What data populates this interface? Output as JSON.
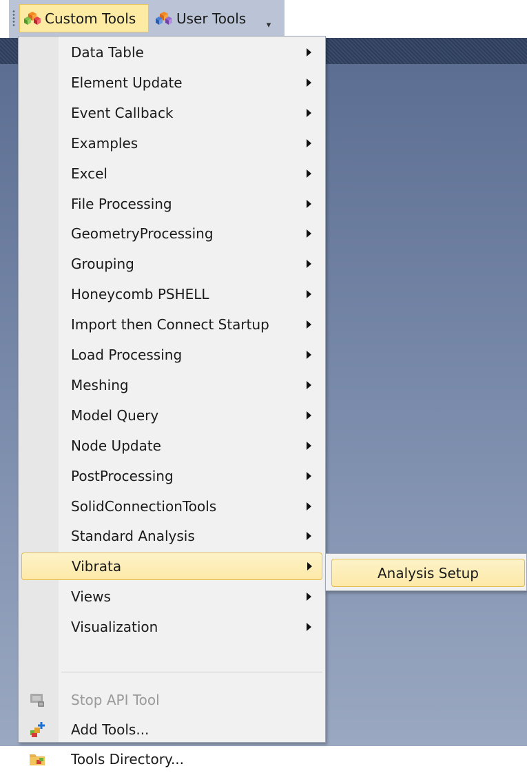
{
  "toolbar": {
    "custom_tools": {
      "label": "Custom Tools",
      "icon": "cubes-icon"
    },
    "user_tools": {
      "label": "User Tools",
      "icon": "cubes-user-icon"
    },
    "overflow_icon": "overflow-chevron-icon"
  },
  "menu": {
    "items": [
      {
        "label": "Data Table",
        "submenu": true
      },
      {
        "label": "Element Update",
        "submenu": true
      },
      {
        "label": "Event Callback",
        "submenu": true
      },
      {
        "label": "Examples",
        "submenu": true
      },
      {
        "label": "Excel",
        "submenu": true
      },
      {
        "label": "File Processing",
        "submenu": true
      },
      {
        "label": "GeometryProcessing",
        "submenu": true
      },
      {
        "label": "Grouping",
        "submenu": true
      },
      {
        "label": "Honeycomb PSHELL",
        "submenu": true
      },
      {
        "label": "Import then Connect Startup",
        "submenu": true
      },
      {
        "label": "Load Processing",
        "submenu": true
      },
      {
        "label": "Meshing",
        "submenu": true
      },
      {
        "label": "Model Query",
        "submenu": true
      },
      {
        "label": "Node Update",
        "submenu": true
      },
      {
        "label": "PostProcessing",
        "submenu": true
      },
      {
        "label": "SolidConnectionTools",
        "submenu": true
      },
      {
        "label": "Standard Analysis",
        "submenu": true
      },
      {
        "label": "Vibrata",
        "submenu": true,
        "highlighted": true
      },
      {
        "label": "Views",
        "submenu": true
      },
      {
        "label": "Visualization",
        "submenu": true
      }
    ],
    "actions": [
      {
        "label": "Stop API Tool",
        "icon": "stop-api-icon",
        "disabled": true
      },
      {
        "label": "Add Tools...",
        "icon": "add-tools-icon",
        "disabled": false
      },
      {
        "label": "Tools Directory...",
        "icon": "tools-directory-icon",
        "disabled": false
      }
    ]
  },
  "submenu": {
    "items": [
      {
        "label": "Analysis Setup",
        "highlighted": true
      }
    ]
  },
  "colors": {
    "highlight": "#fde9a8",
    "highlight_border": "#e2b94d",
    "menu_bg": "#f1f1f1",
    "workspace_top": "#5c6e92"
  }
}
